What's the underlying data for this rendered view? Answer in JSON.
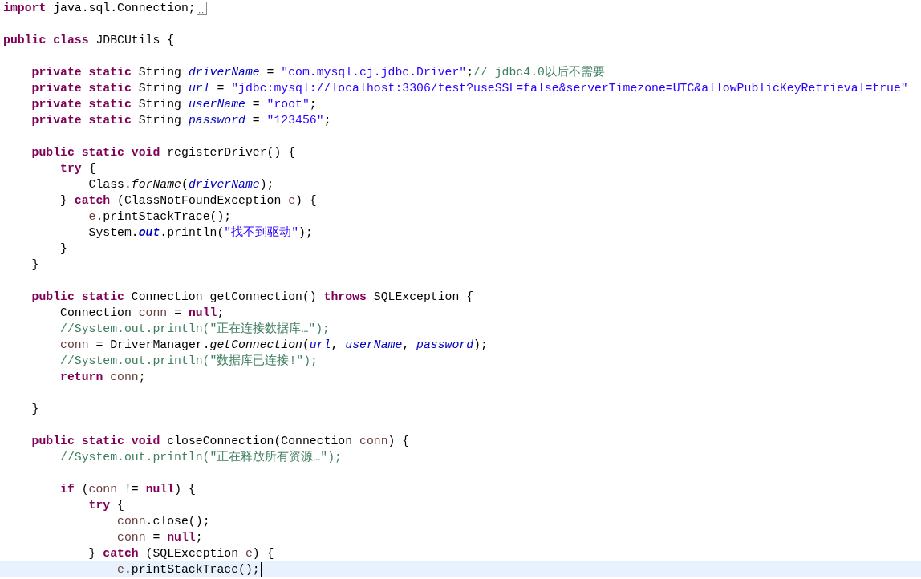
{
  "editor": {
    "lines": [
      {
        "current": false,
        "folded": true,
        "tokens": [
          {
            "kind": "keyword",
            "text": "import"
          },
          {
            "kind": "plain",
            "text": " java.sql.Connection;"
          }
        ]
      },
      {
        "current": false,
        "folded": false
      },
      {
        "current": false,
        "folded": false,
        "tokens": [
          {
            "kind": "keyword",
            "text": "public class"
          },
          {
            "kind": "plain",
            "text": " JDBCUtils {"
          }
        ]
      },
      {
        "current": false,
        "folded": false
      },
      {
        "current": false,
        "folded": false,
        "tokens": [
          {
            "kind": "keyword",
            "text": "    private static"
          },
          {
            "kind": "plain",
            "text": " String "
          },
          {
            "kind": "field",
            "text": "driverName"
          },
          {
            "kind": "plain",
            "text": " = "
          },
          {
            "kind": "string",
            "text": "\"com.mysql.cj.jdbc.Driver\""
          },
          {
            "kind": "plain",
            "text": ";"
          },
          {
            "kind": "comment",
            "text": "// jdbc4.0以后不需要"
          }
        ]
      },
      {
        "current": false,
        "folded": false,
        "tokens": [
          {
            "kind": "keyword",
            "text": "    private static"
          },
          {
            "kind": "plain",
            "text": " String "
          },
          {
            "kind": "field",
            "text": "url"
          },
          {
            "kind": "plain",
            "text": " = "
          },
          {
            "kind": "string",
            "text": "\"jdbc:mysql://localhost:3306/test?useSSL=false&serverTimezone=UTC&allowPublicKeyRetrieval=true\""
          }
        ]
      },
      {
        "current": false,
        "folded": false,
        "tokens": [
          {
            "kind": "keyword",
            "text": "    private static"
          },
          {
            "kind": "plain",
            "text": " String "
          },
          {
            "kind": "field",
            "text": "userName"
          },
          {
            "kind": "plain",
            "text": " = "
          },
          {
            "kind": "string",
            "text": "\"root\""
          },
          {
            "kind": "plain",
            "text": ";"
          }
        ]
      },
      {
        "current": false,
        "folded": false,
        "tokens": [
          {
            "kind": "keyword",
            "text": "    private static"
          },
          {
            "kind": "plain",
            "text": " String "
          },
          {
            "kind": "field",
            "text": "password"
          },
          {
            "kind": "plain",
            "text": " = "
          },
          {
            "kind": "string",
            "text": "\"123456\""
          },
          {
            "kind": "plain",
            "text": ";"
          }
        ]
      },
      {
        "current": false,
        "folded": false
      },
      {
        "current": false,
        "folded": false,
        "tokens": [
          {
            "kind": "keyword",
            "text": "    public static void"
          },
          {
            "kind": "plain",
            "text": " registerDriver() {"
          }
        ]
      },
      {
        "current": false,
        "folded": false,
        "tokens": [
          {
            "kind": "keyword",
            "text": "        try"
          },
          {
            "kind": "plain",
            "text": " {"
          }
        ]
      },
      {
        "current": false,
        "folded": false,
        "tokens": [
          {
            "kind": "plain",
            "text": "            Class."
          },
          {
            "kind": "method",
            "text": "forName"
          },
          {
            "kind": "plain",
            "text": "("
          },
          {
            "kind": "field",
            "text": "driverName"
          },
          {
            "kind": "plain",
            "text": ");"
          }
        ]
      },
      {
        "current": false,
        "folded": false,
        "tokens": [
          {
            "kind": "plain",
            "text": "        } "
          },
          {
            "kind": "keyword",
            "text": "catch"
          },
          {
            "kind": "plain",
            "text": " (ClassNotFoundException "
          },
          {
            "kind": "local",
            "text": "e"
          },
          {
            "kind": "plain",
            "text": ") {"
          }
        ]
      },
      {
        "current": false,
        "folded": false,
        "tokens": [
          {
            "kind": "local",
            "text": "            e"
          },
          {
            "kind": "plain",
            "text": ".printStackTrace();"
          }
        ]
      },
      {
        "current": false,
        "folded": false,
        "tokens": [
          {
            "kind": "plain",
            "text": "            System."
          },
          {
            "kind": "constant",
            "text": "out"
          },
          {
            "kind": "plain",
            "text": ".println("
          },
          {
            "kind": "string",
            "text": "\"找不到驱动\""
          },
          {
            "kind": "plain",
            "text": ");"
          }
        ]
      },
      {
        "current": false,
        "folded": false,
        "tokens": [
          {
            "kind": "plain",
            "text": "        }"
          }
        ]
      },
      {
        "current": false,
        "folded": false,
        "tokens": [
          {
            "kind": "plain",
            "text": "    }"
          }
        ]
      },
      {
        "current": false,
        "folded": false
      },
      {
        "current": false,
        "folded": false,
        "tokens": [
          {
            "kind": "keyword",
            "text": "    public static"
          },
          {
            "kind": "plain",
            "text": " Connection getConnection() "
          },
          {
            "kind": "keyword",
            "text": "throws"
          },
          {
            "kind": "plain",
            "text": " SQLException {"
          }
        ]
      },
      {
        "current": false,
        "folded": false,
        "tokens": [
          {
            "kind": "plain",
            "text": "        Connection "
          },
          {
            "kind": "local",
            "text": "conn"
          },
          {
            "kind": "plain",
            "text": " = "
          },
          {
            "kind": "keyword",
            "text": "null"
          },
          {
            "kind": "plain",
            "text": ";"
          }
        ]
      },
      {
        "current": false,
        "folded": false,
        "tokens": [
          {
            "kind": "comment",
            "text": "        //System.out.println(\"正在连接数据库…\");"
          }
        ]
      },
      {
        "current": false,
        "folded": false,
        "tokens": [
          {
            "kind": "local",
            "text": "        conn"
          },
          {
            "kind": "plain",
            "text": " = DriverManager."
          },
          {
            "kind": "method",
            "text": "getConnection"
          },
          {
            "kind": "plain",
            "text": "("
          },
          {
            "kind": "field",
            "text": "url"
          },
          {
            "kind": "plain",
            "text": ", "
          },
          {
            "kind": "field",
            "text": "userName"
          },
          {
            "kind": "plain",
            "text": ", "
          },
          {
            "kind": "field",
            "text": "password"
          },
          {
            "kind": "plain",
            "text": ");"
          }
        ]
      },
      {
        "current": false,
        "folded": false,
        "tokens": [
          {
            "kind": "comment",
            "text": "        //System.out.println(\"数据库已连接!\");"
          }
        ]
      },
      {
        "current": false,
        "folded": false,
        "tokens": [
          {
            "kind": "keyword",
            "text": "        return"
          },
          {
            "kind": "local",
            "text": " conn"
          },
          {
            "kind": "plain",
            "text": ";"
          }
        ]
      },
      {
        "current": false,
        "folded": false
      },
      {
        "current": false,
        "folded": false,
        "tokens": [
          {
            "kind": "plain",
            "text": "    }"
          }
        ]
      },
      {
        "current": false,
        "folded": false
      },
      {
        "current": false,
        "folded": false,
        "tokens": [
          {
            "kind": "keyword",
            "text": "    public static void"
          },
          {
            "kind": "plain",
            "text": " closeConnection(Connection "
          },
          {
            "kind": "local",
            "text": "conn"
          },
          {
            "kind": "plain",
            "text": ") {"
          }
        ]
      },
      {
        "current": false,
        "folded": false,
        "tokens": [
          {
            "kind": "comment",
            "text": "        //System.out.println(\"正在释放所有资源…\");"
          }
        ]
      },
      {
        "current": false,
        "folded": false
      },
      {
        "current": false,
        "folded": false,
        "tokens": [
          {
            "kind": "keyword",
            "text": "        if"
          },
          {
            "kind": "plain",
            "text": " ("
          },
          {
            "kind": "local",
            "text": "conn"
          },
          {
            "kind": "plain",
            "text": " != "
          },
          {
            "kind": "keyword",
            "text": "null"
          },
          {
            "kind": "plain",
            "text": ") {"
          }
        ]
      },
      {
        "current": false,
        "folded": false,
        "tokens": [
          {
            "kind": "keyword",
            "text": "            try"
          },
          {
            "kind": "plain",
            "text": " {"
          }
        ]
      },
      {
        "current": false,
        "folded": false,
        "tokens": [
          {
            "kind": "local",
            "text": "                conn"
          },
          {
            "kind": "plain",
            "text": ".close();"
          }
        ]
      },
      {
        "current": false,
        "folded": false,
        "tokens": [
          {
            "kind": "local",
            "text": "                conn"
          },
          {
            "kind": "plain",
            "text": " = "
          },
          {
            "kind": "keyword",
            "text": "null"
          },
          {
            "kind": "plain",
            "text": ";"
          }
        ]
      },
      {
        "current": false,
        "folded": false,
        "tokens": [
          {
            "kind": "plain",
            "text": "            } "
          },
          {
            "kind": "keyword",
            "text": "catch"
          },
          {
            "kind": "plain",
            "text": " (SQLException "
          },
          {
            "kind": "local",
            "text": "e"
          },
          {
            "kind": "plain",
            "text": ") {"
          }
        ]
      },
      {
        "current": true,
        "folded": false,
        "tokens": [
          {
            "kind": "local",
            "text": "                e"
          },
          {
            "kind": "plain",
            "text": ".printStackTrace();"
          }
        ]
      }
    ]
  }
}
